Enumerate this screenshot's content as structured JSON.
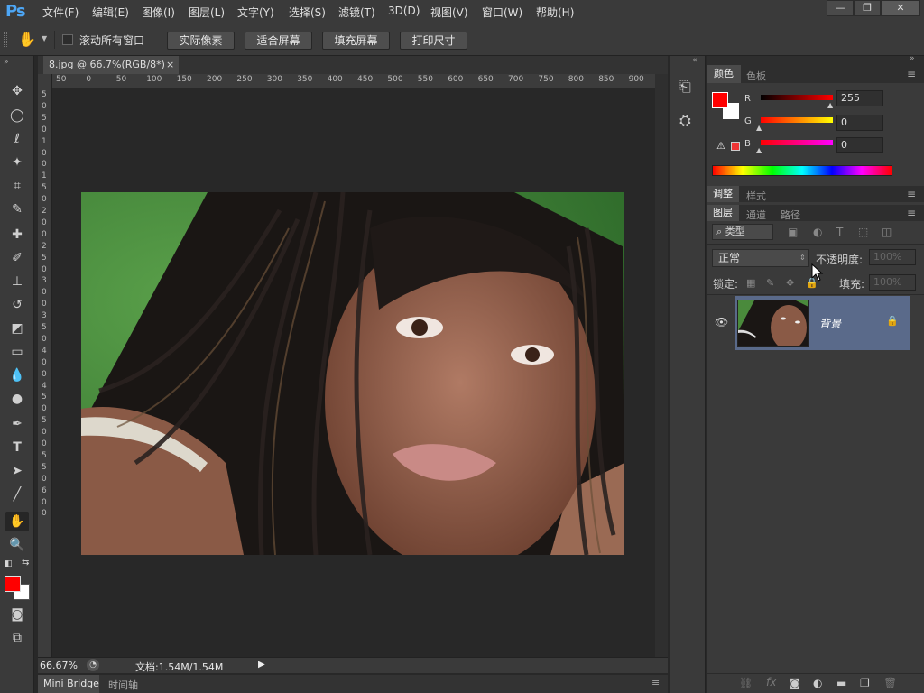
{
  "app": {
    "logo": "Ps"
  },
  "menu": [
    "文件(F)",
    "编辑(E)",
    "图像(I)",
    "图层(L)",
    "文字(Y)",
    "选择(S)",
    "滤镜(T)",
    "3D(D)",
    "视图(V)",
    "窗口(W)",
    "帮助(H)"
  ],
  "window_controls": {
    "minimize": "—",
    "restore": "❐",
    "close": "✕"
  },
  "options": {
    "scroll_all_label": "滚动所有窗口",
    "buttons": [
      "实际像素",
      "适合屏幕",
      "填充屏幕",
      "打印尺寸"
    ]
  },
  "document": {
    "tab_title": "8.jpg @ 66.7%(RGB/8*)",
    "close": "×"
  },
  "ruler": {
    "h_ticks": [
      "50",
      "0",
      "50",
      "100",
      "150",
      "200",
      "250",
      "300",
      "350",
      "400",
      "450",
      "500",
      "550",
      "600",
      "650",
      "700",
      "750",
      "800",
      "850",
      "900"
    ],
    "v_ticks": [
      "5",
      "0",
      "5",
      "0",
      "1",
      "0",
      "0",
      "1",
      "5",
      "0",
      "2",
      "0",
      "0",
      "2",
      "5",
      "0",
      "3",
      "0",
      "0",
      "3",
      "5",
      "0",
      "4",
      "0",
      "0",
      "4",
      "5",
      "0",
      "5",
      "0",
      "0",
      "5",
      "5",
      "0",
      "6",
      "0",
      "0"
    ]
  },
  "status": {
    "zoom": "66.67%",
    "doc_info": "文档:1.54M/1.54M"
  },
  "bottom_tabs": [
    "Mini Bridge",
    "时间轴"
  ],
  "color_panel": {
    "tabs": [
      "颜色",
      "色板"
    ],
    "r_label": "R",
    "g_label": "G",
    "b_label": "B",
    "r_value": "255",
    "g_value": "0",
    "b_value": "0",
    "foreground": "#ff0000",
    "background": "#ffffff"
  },
  "adjust_tabs": [
    "调整",
    "样式"
  ],
  "layers_panel": {
    "tabs": [
      "图层",
      "通道",
      "路径"
    ],
    "filter_kind": "类型",
    "blend_mode": "正常",
    "opacity_label": "不透明度:",
    "opacity_value": "100%",
    "lock_label": "锁定:",
    "fill_label": "填充:",
    "fill_value": "100%",
    "layer_name": "背景"
  }
}
